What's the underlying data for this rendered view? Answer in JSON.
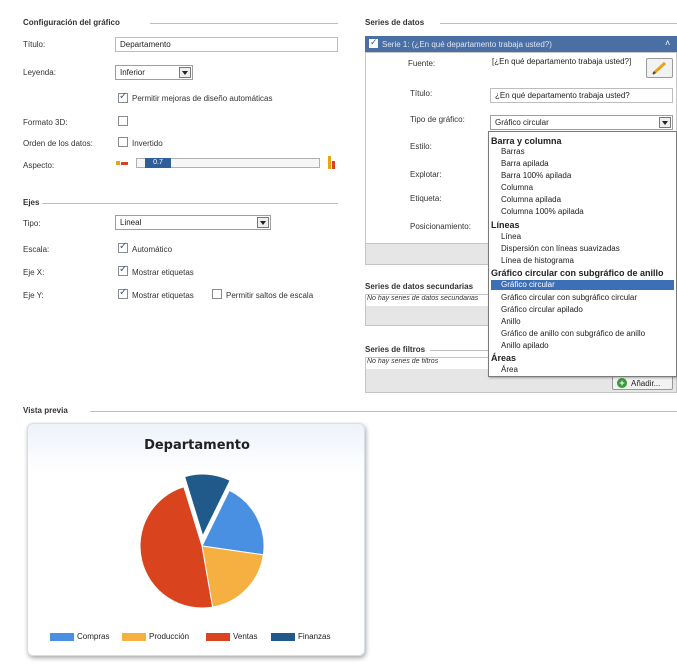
{
  "config": {
    "title": "Configuración del gráfico",
    "titulo_label": "Título:",
    "titulo_value": "Departamento",
    "leyenda_label": "Leyenda:",
    "leyenda_value": "Inferior",
    "permit_label": "Permitir mejoras de diseño automáticas",
    "formato3d_label": "Formato 3D:",
    "orden_label": "Orden de los datos:",
    "invertido_label": "Invertido",
    "aspecto_label": "Aspecto:",
    "aspecto_value": "0.7",
    "aspecto_level": 0.3
  },
  "ejes": {
    "title": "Ejes",
    "tipo_label": "Tipo:",
    "tipo_value": "Lineal",
    "escala_label": "Escala:",
    "automatico_label": "Automático",
    "ejex_label": "Eje X:",
    "ejex_check": "Mostrar etiquetas",
    "ejey_label": "Eje Y:",
    "ejey_check": "Mostrar etiquetas",
    "saltos_label": "Permitir saltos de escala"
  },
  "series": {
    "title": "Series de datos",
    "serie_header": "Serie 1: (¿En qué departamento trabaja usted?)",
    "fuente_label": "Fuente:",
    "fuente_value": "[¿En qué departamento trabaja usted?]",
    "titulo_label": "Título:",
    "titulo_value": "¿En qué departamento trabaja usted?",
    "tipo_label": "Tipo de gráfico:",
    "tipo_value": "Gráfico circular",
    "estilo_label": "Estilo:",
    "explotar_label": "Explotar:",
    "etiqueta_label": "Etiqueta:",
    "posicionamiento_label": "Posicionamiento:"
  },
  "dropdown": {
    "groups": [
      {
        "head": "Barra y columna",
        "items": [
          "Barras",
          "Barra apilada",
          "Barra 100% apilada",
          "Columna",
          "Columna apilada",
          "Columna 100% apilada"
        ]
      },
      {
        "head": "Líneas",
        "items": [
          "Línea",
          "Dispersión con líneas suavizadas",
          "Línea de histograma"
        ]
      },
      {
        "head": "Gráfico circular con subgráfico de anillo",
        "items": [
          "Gráfico circular",
          "Gráfico circular con subgráfico circular",
          "Gráfico circular apilado",
          "Anillo",
          "Gráfico de anillo con subgráfico de anillo",
          "Anillo apilado"
        ]
      },
      {
        "head": "Áreas",
        "items": [
          "Área"
        ]
      }
    ],
    "selected": "Gráfico circular"
  },
  "secundarias": {
    "title": "Series de datos secundarias",
    "empty": "No hay series de datos secundarias"
  },
  "filtros": {
    "title": "Series de filtros",
    "empty": "No hay series de filtros",
    "add_button": "Añadir..."
  },
  "preview": {
    "title": "Vista previa"
  },
  "chart_data": {
    "type": "pie",
    "title": "Departamento",
    "categories": [
      "Compras",
      "Producción",
      "Ventas",
      "Finanzas"
    ],
    "values": [
      20,
      20,
      48,
      12
    ],
    "colors": [
      "#4a90e2",
      "#f5b041",
      "#d9431e",
      "#1f5a8a"
    ],
    "explode": [
      0,
      0,
      0,
      1
    ],
    "legend_position": "bottom"
  }
}
